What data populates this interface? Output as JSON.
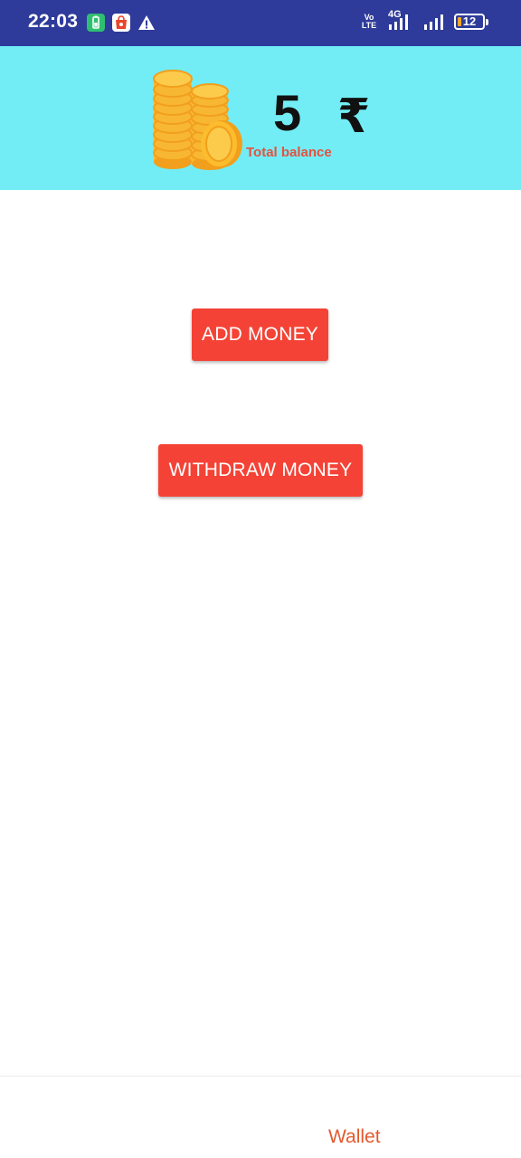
{
  "status_bar": {
    "time": "22:03",
    "volte_line1": "Vo",
    "volte_line2": "LTE",
    "network_type": "4G",
    "battery_level": "12"
  },
  "header": {
    "balance_value": "5",
    "currency_symbol": "₹",
    "balance_label": "Total balance"
  },
  "actions": {
    "add_money_label": "ADD MONEY",
    "withdraw_money_label": "WITHDRAW MONEY"
  },
  "bottom_nav": {
    "items": [
      {
        "label": "Wallet"
      }
    ]
  },
  "colors": {
    "status_bar_bg": "#2e3b9a",
    "header_bg": "#72edf5",
    "button_bg": "#f44336",
    "label_accent": "#e5513f",
    "nav_active": "#e35a2e"
  }
}
